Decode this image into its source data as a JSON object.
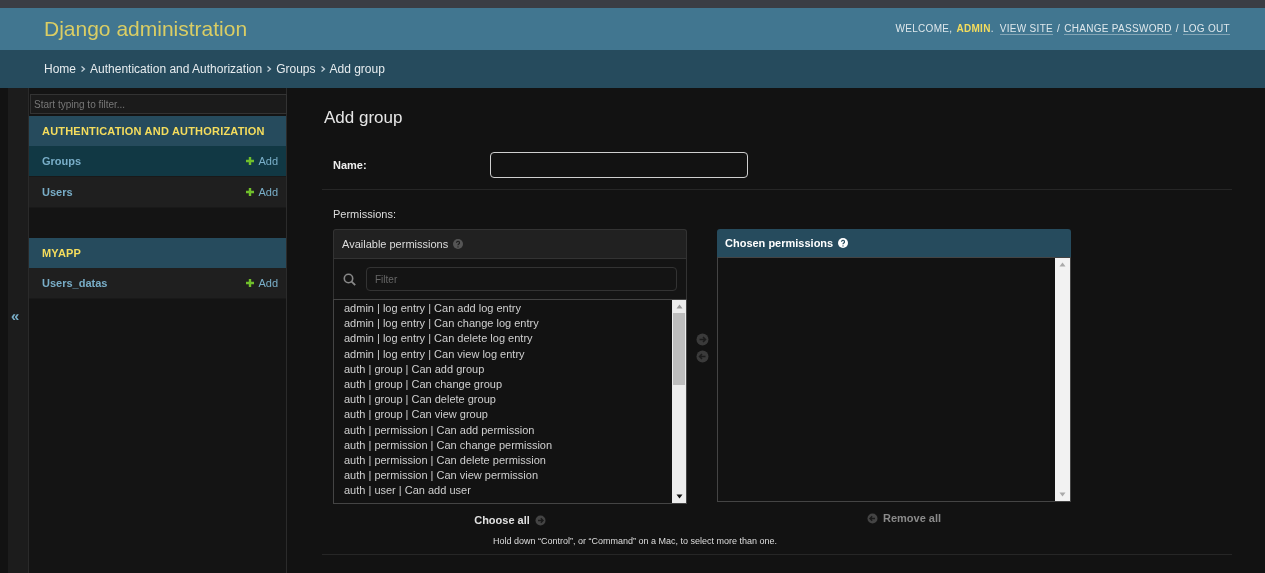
{
  "header": {
    "branding": "Django administration",
    "welcome": "WELCOME,",
    "user": "ADMIN",
    "user_suffix": ".",
    "link_separator": "/",
    "user_links": [
      "VIEW SITE",
      "CHANGE PASSWORD",
      "LOG OUT"
    ]
  },
  "breadcrumbs": [
    "Home",
    "Authentication and Authorization",
    "Groups",
    "Add group"
  ],
  "sidebar": {
    "filter_placeholder": "Start typing to filter...",
    "toggle": "«",
    "modules": [
      {
        "caption": "AUTHENTICATION AND AUTHORIZATION",
        "items": [
          {
            "label": "Groups",
            "add": "Add",
            "selected": true
          },
          {
            "label": "Users",
            "add": "Add",
            "selected": false
          }
        ]
      },
      {
        "caption": "MYAPP",
        "items": [
          {
            "label": "Users_datas",
            "add": "Add",
            "selected": false
          }
        ]
      }
    ]
  },
  "content": {
    "title": "Add group",
    "name_label": "Name:",
    "permissions_label": "Permissions:",
    "available": {
      "title": "Available permissions",
      "filter_placeholder": "Filter",
      "options": [
        "admin | log entry | Can add log entry",
        "admin | log entry | Can change log entry",
        "admin | log entry | Can delete log entry",
        "admin | log entry | Can view log entry",
        "auth | group | Can add group",
        "auth | group | Can change group",
        "auth | group | Can delete group",
        "auth | group | Can view group",
        "auth | permission | Can add permission",
        "auth | permission | Can change permission",
        "auth | permission | Can delete permission",
        "auth | permission | Can view permission",
        "auth | user | Can add user"
      ],
      "action": "Choose all"
    },
    "chosen": {
      "title": "Chosen permissions",
      "action": "Remove all"
    },
    "help": "Hold down “Control”, or “Command” on a Mac, to select more than one."
  }
}
